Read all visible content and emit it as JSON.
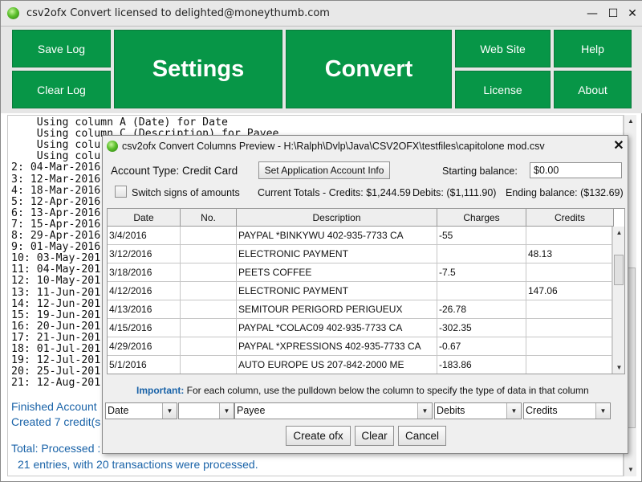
{
  "main_window": {
    "title": "csv2ofx Convert licensed to delighted@moneythumb.com",
    "controls": {
      "minimize": "—",
      "maximize": "☐",
      "close": "✕"
    }
  },
  "buttons": {
    "save_log": "Save Log",
    "clear_log": "Clear Log",
    "settings": "Settings",
    "convert": "Convert",
    "web_site": "Web Site",
    "help": "Help",
    "license": "License",
    "about": "About"
  },
  "log": {
    "lines": [
      "    Using column A (Date) for Date",
      "    Using column C (Description) for Payee",
      "    Using colu",
      "    Using colu",
      "2: 04-Mar-2016",
      "3: 12-Mar-2016",
      "4: 18-Mar-2016",
      "5: 12-Apr-2016",
      "6: 13-Apr-2016",
      "7: 15-Apr-2016",
      "8: 29-Apr-2016",
      "9: 01-May-2016",
      "10: 03-May-201",
      "11: 04-May-201",
      "12: 10-May-201",
      "13: 11-Jun-201",
      "14: 12-Jun-201",
      "15: 19-Jun-201",
      "16: 20-Jun-201",
      "17: 21-Jun-201",
      "18: 01-Jul-201",
      "19: 12-Jul-201",
      "20: 25-Jul-201",
      "21: 12-Aug-201"
    ],
    "finished": "Finished Account",
    "created": "Created 7 credit(s",
    "total": "Total: Processed :",
    "summary": "21 entries, with 20 transactions were processed."
  },
  "dialog": {
    "title": "csv2ofx Convert Columns Preview - H:\\Ralph\\Dvlp\\Java\\CSV2OFX\\testfiles\\capitolone mod.csv",
    "close": "✕",
    "account_type_label": "Account Type: Credit Card",
    "set_account_button": "Set Application Account Info",
    "starting_balance_label": "Starting balance:",
    "starting_balance_value": "$0.00",
    "switch_signs_label": "Switch signs of amounts",
    "current_totals": "Current Totals - Credits: $1,244.59",
    "debits_total": "Debits: ($1,111.90)",
    "ending_balance": "Ending balance: ($132.69)",
    "table": {
      "headers": [
        "Date",
        "No.",
        "Description",
        "Charges",
        "Credits"
      ],
      "rows": [
        [
          "3/4/2016",
          "",
          "PAYPAL *BINKYWU 402-935-7733 CA",
          "-55",
          ""
        ],
        [
          "3/12/2016",
          "",
          "ELECTRONIC PAYMENT",
          "",
          "48.13"
        ],
        [
          "3/18/2016",
          "",
          "PEETS COFFEE",
          "-7.5",
          ""
        ],
        [
          "4/12/2016",
          "",
          "ELECTRONIC PAYMENT",
          "",
          "147.06"
        ],
        [
          "4/13/2016",
          "",
          "SEMITOUR PERIGORD PERIGUEUX",
          "-26.78",
          ""
        ],
        [
          "4/15/2016",
          "",
          "PAYPAL *COLAC09 402-935-7733 CA",
          "-302.35",
          ""
        ],
        [
          "4/29/2016",
          "",
          "PAYPAL *XPRESSIONS 402-935-7733 CA",
          "-0.67",
          ""
        ],
        [
          "5/1/2016",
          "",
          "AUTO EUROPE US 207-842-2000 ME",
          "-183.86",
          ""
        ]
      ]
    },
    "important_label": "Important:",
    "important_text": " For each column, use the pulldown below the column to specify the type of data in that column",
    "dropdowns": [
      "Date",
      "",
      "Payee",
      "Debits",
      "Credits"
    ],
    "create_button": "Create ofx",
    "clear_button": "Clear",
    "cancel_button": "Cancel"
  },
  "colors": {
    "button_green": "#079647",
    "log_blue": "#1a63a8",
    "important_blue": "#1a63a8"
  }
}
